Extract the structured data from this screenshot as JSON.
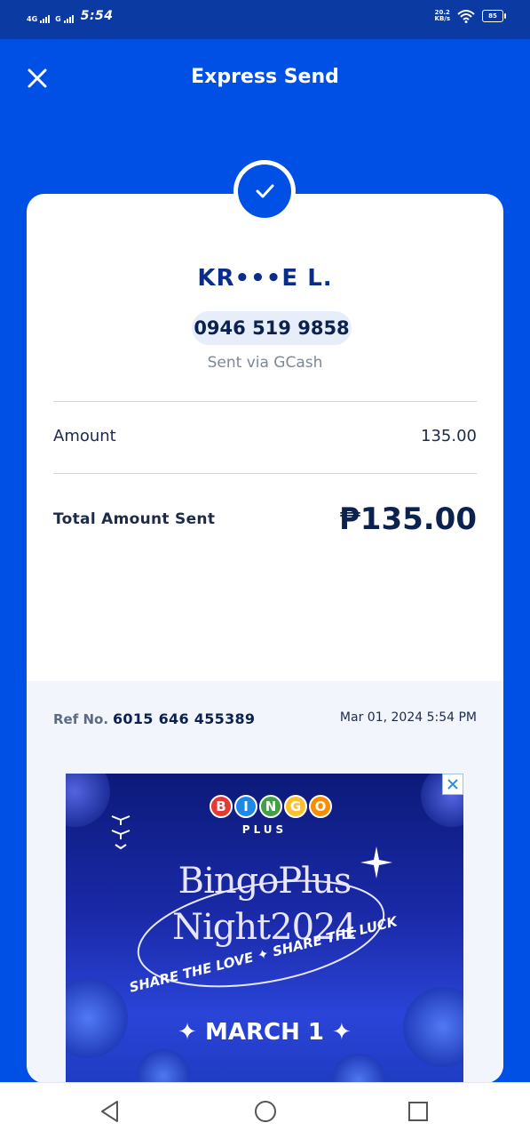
{
  "status_bar": {
    "network1": "4G",
    "network2": "G",
    "time": "5:54",
    "net_speed_top": "20.2",
    "net_speed_bottom": "KB/s",
    "battery": "85"
  },
  "header": {
    "title": "Express Send",
    "close_icon": "close-icon"
  },
  "receipt": {
    "recipient_name": "KR•••E L.",
    "phone": "0946 519 9858",
    "sent_via": "Sent via GCash",
    "amount_label": "Amount",
    "amount_value": "135.00",
    "total_label": "Total Amount Sent",
    "total_value": "₱135.00",
    "ref_label": "Ref No.",
    "ref_value": "6015 646 455389",
    "datetime": "Mar 01, 2024 5:54 PM"
  },
  "ad": {
    "logo_letters": [
      "B",
      "I",
      "N",
      "G",
      "O"
    ],
    "logo_colors": [
      "#e53935",
      "#1e88e5",
      "#43a047",
      "#fbc02d",
      "#fb8c00"
    ],
    "logo_sub": "PLUS",
    "title_line1": "BingoPlus",
    "title_line2": "Night2024",
    "tagline": "SHARE THE LOVE ✦ SHARE THE LUCK",
    "date": "✦ MARCH 1 ✦"
  },
  "nav": {
    "back_icon": "back-triangle-icon",
    "home_icon": "home-circle-icon",
    "recents_icon": "recents-square-icon"
  },
  "colors": {
    "brand_blue": "#0050e6",
    "status_bar": "#0b3aa3",
    "navy_text": "#0b2150"
  }
}
